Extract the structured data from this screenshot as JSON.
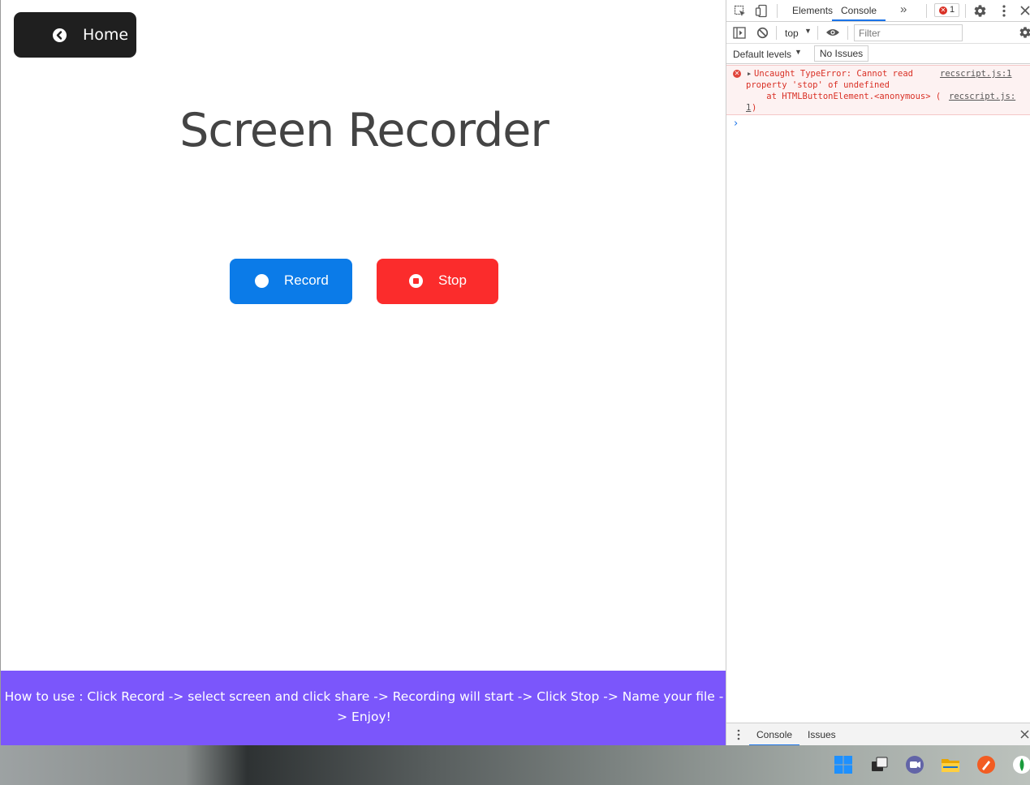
{
  "page": {
    "home_label": "Home",
    "title": "Screen Recorder",
    "record_label": "Record",
    "stop_label": "Stop",
    "howto_line1": "How to use : Click Record -> select screen and click share -> Recording will start -> Click Stop -> Name your file -",
    "howto_line2": "> Enjoy!",
    "colors": {
      "record": "#0b7be8",
      "stop": "#fb2c2c",
      "footer": "#7b56fb",
      "home": "#1f1f1f"
    }
  },
  "devtools": {
    "tabs": [
      "Elements",
      "Console"
    ],
    "more_tabs": "»",
    "error_count": "1",
    "context": "top",
    "filter_placeholder": "Filter",
    "levels": "Default levels",
    "issues": "No Issues",
    "error": {
      "line1": "Uncaught TypeError: Cannot read",
      "line2": "property 'stop' of undefined",
      "line3": "    at HTMLButtonElement.<anonymous> (",
      "source": "recscript.js:1",
      "source2": "recscript.js:",
      "source2b": "1",
      "close_paren": ")"
    },
    "prompt": "›",
    "drawer_tabs": [
      "Console",
      "Issues"
    ]
  },
  "taskbar": {
    "icons": [
      "windows-start-icon",
      "task-view-icon",
      "teams-chat-icon",
      "file-explorer-icon",
      "app-orange-icon",
      "app-green-icon"
    ]
  }
}
